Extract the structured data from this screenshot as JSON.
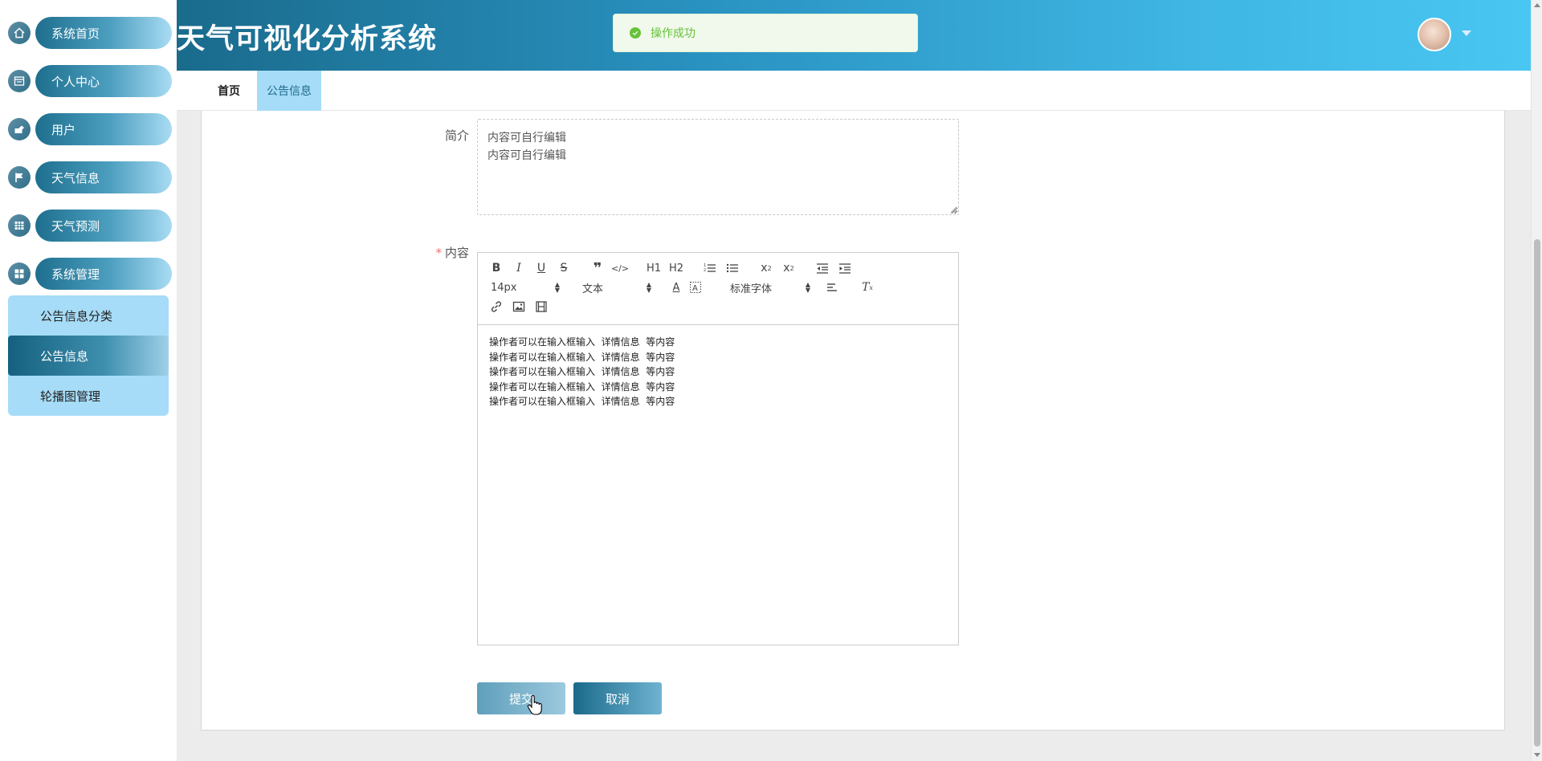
{
  "app": {
    "title": "天气可视化分析系统"
  },
  "toast": {
    "message": "操作成功",
    "color": "#67c23a"
  },
  "sidebar": {
    "items": [
      {
        "label": "系统首页",
        "icon": "home-icon"
      },
      {
        "label": "个人中心",
        "icon": "profile-card-icon"
      },
      {
        "label": "用户",
        "icon": "user-icon"
      },
      {
        "label": "天气信息",
        "icon": "flag-icon"
      },
      {
        "label": "天气预测",
        "icon": "grid-icon"
      },
      {
        "label": "系统管理",
        "icon": "apps-icon"
      }
    ],
    "submenu": [
      {
        "label": "公告信息分类"
      },
      {
        "label": "公告信息",
        "active": true
      },
      {
        "label": "轮播图管理"
      }
    ]
  },
  "tabs": [
    {
      "label": "首页"
    },
    {
      "label": "公告信息",
      "active": true
    }
  ],
  "form": {
    "intro_label": "简介",
    "intro_value": "内容可自行编辑\n内容可自行编辑",
    "content_label": "内容",
    "content_required_mark": "*",
    "toolbar": {
      "font_size": "14px",
      "block_type": "文本",
      "font_family": "标准字体",
      "h1": "H1",
      "h2": "H2"
    },
    "content_lines": [
      "操作者可以在输入框输入  详情信息  等内容",
      "操作者可以在输入框输入  详情信息  等内容",
      "操作者可以在输入框输入  详情信息  等内容",
      "操作者可以在输入框输入  详情信息  等内容",
      "操作者可以在输入框输入  详情信息  等内容"
    ],
    "submit_label": "提交",
    "cancel_label": "取消"
  },
  "colors": {
    "header_start": "#1a6b8c",
    "header_end": "#49c6f2",
    "submenu_bg": "#a6dcf7",
    "required": "#f56c6c"
  }
}
